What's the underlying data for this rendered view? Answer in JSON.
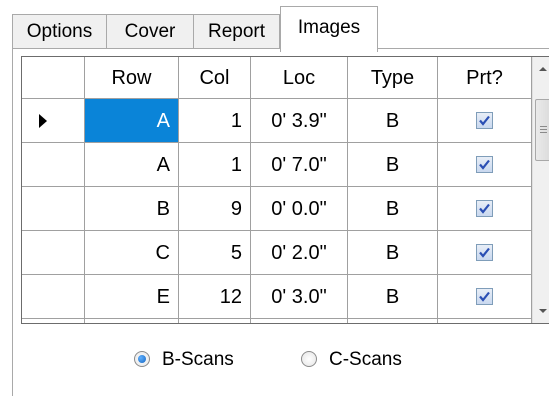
{
  "tabs": [
    {
      "label": "Options",
      "active": false
    },
    {
      "label": "Cover",
      "active": false
    },
    {
      "label": "Report",
      "active": false
    },
    {
      "label": "Images",
      "active": true
    }
  ],
  "grid": {
    "columns": [
      "Row",
      "Col",
      "Loc",
      "Type",
      "Prt?"
    ],
    "rows": [
      {
        "row": "A",
        "col": "1",
        "loc": "0' 3.9\"",
        "type": "B",
        "prt": true,
        "current": true,
        "selected_cell": "row"
      },
      {
        "row": "A",
        "col": "1",
        "loc": "0' 7.0\"",
        "type": "B",
        "prt": true
      },
      {
        "row": "B",
        "col": "9",
        "loc": "0' 0.0\"",
        "type": "B",
        "prt": true
      },
      {
        "row": "C",
        "col": "5",
        "loc": "0' 2.0\"",
        "type": "B",
        "prt": true
      },
      {
        "row": "E",
        "col": "12",
        "loc": "0' 3.0\"",
        "type": "B",
        "prt": true
      }
    ]
  },
  "scan_mode": {
    "options": [
      {
        "label": "B-Scans",
        "selected": true
      },
      {
        "label": "C-Scans",
        "selected": false
      }
    ]
  },
  "colors": {
    "selection": "#0a84d8",
    "grid_line": "#a0a0a0",
    "check": "#2b4fb4"
  },
  "icons": {
    "row_indicator": "current-row-arrow-icon",
    "scroll_up": "arrow-up-icon",
    "scroll_down": "arrow-down-icon",
    "checkbox": "checkmark-icon",
    "radio": "radio-dot-icon"
  }
}
